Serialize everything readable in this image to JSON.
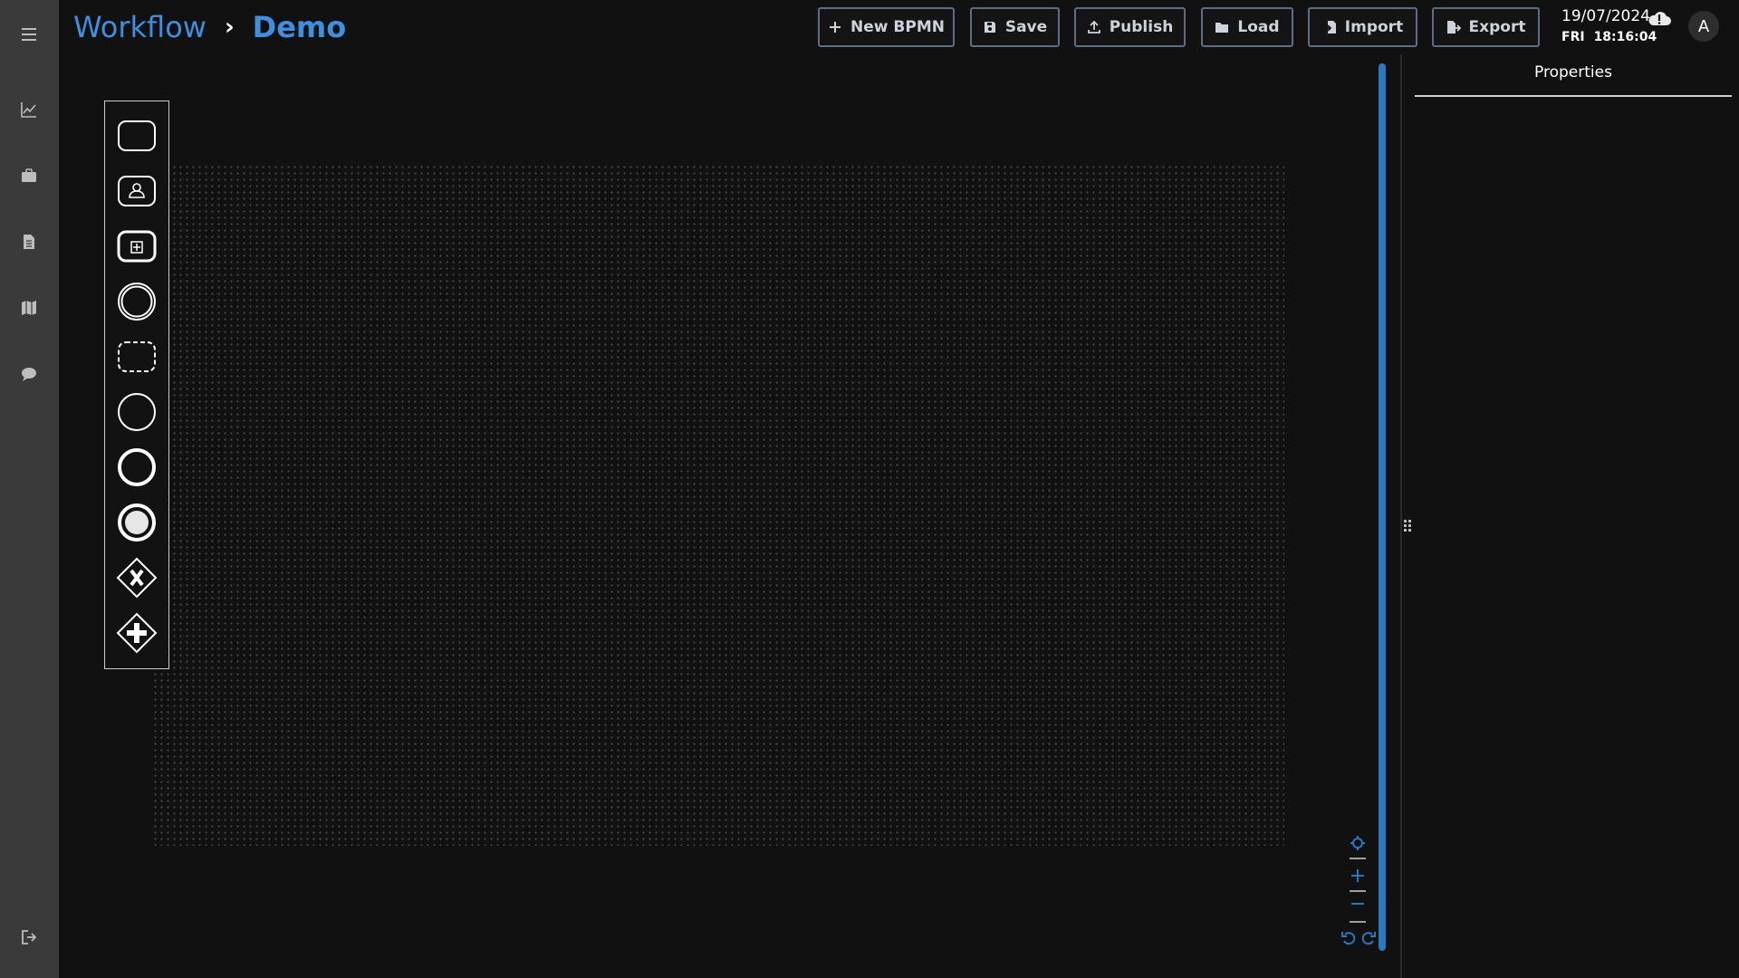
{
  "breadcrumb": {
    "root": "Workflow",
    "separator": "›",
    "current": "Demo"
  },
  "toolbar": {
    "new_label": "New BPMN",
    "save_label": "Save",
    "publish_label": "Publish",
    "load_label": "Load",
    "import_label": "Import",
    "export_label": "Export"
  },
  "status": {
    "date": "19/07/2024",
    "day": "FRI",
    "time": "18:16:04",
    "sync_icon": "cloud-alert-icon"
  },
  "user": {
    "avatar_initial": "A"
  },
  "sidebar": {
    "items": [
      {
        "name": "menu",
        "icon": "hamburger-menu-icon"
      },
      {
        "name": "analytics",
        "icon": "line-chart-icon"
      },
      {
        "name": "cases",
        "icon": "briefcase-icon"
      },
      {
        "name": "documents",
        "icon": "document-icon"
      },
      {
        "name": "map",
        "icon": "map-icon"
      },
      {
        "name": "chat",
        "icon": "chat-bubble-icon"
      },
      {
        "name": "logout",
        "icon": "logout-icon"
      }
    ]
  },
  "palette": {
    "tools": [
      {
        "name": "task",
        "icon": "task-icon"
      },
      {
        "name": "user-task",
        "icon": "user-task-icon"
      },
      {
        "name": "subprocess",
        "icon": "subprocess-icon"
      },
      {
        "name": "intermediate-event",
        "icon": "intermediate-event-icon"
      },
      {
        "name": "group",
        "icon": "group-icon"
      },
      {
        "name": "start-event",
        "icon": "start-event-icon"
      },
      {
        "name": "end-event",
        "icon": "end-event-icon"
      },
      {
        "name": "terminate-end-event",
        "icon": "terminate-end-event-icon"
      },
      {
        "name": "exclusive-gateway",
        "icon": "exclusive-gateway-icon"
      },
      {
        "name": "parallel-gateway",
        "icon": "parallel-gateway-icon"
      }
    ]
  },
  "properties": {
    "title": "Properties"
  },
  "colors": {
    "accent": "#3f8fe0",
    "background": "#111111",
    "sidebar": "#3a3a3a",
    "button_border": "#5b6e83",
    "scrollbar": "#2a78c2"
  }
}
